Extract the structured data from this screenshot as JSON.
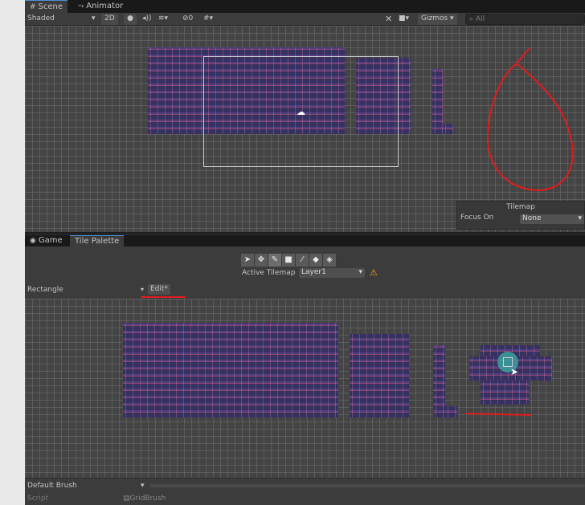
{
  "scene_tabs": [
    {
      "label": "Scene",
      "icon": "hash-icon"
    },
    {
      "label": "Animator",
      "icon": "animator-icon"
    }
  ],
  "scene_toolbar": {
    "shading_mode": "Shaded",
    "mode_2d": "2D",
    "effects_count": "0",
    "gizmos": "Gizmos",
    "search_placeholder": "All"
  },
  "tilemap_overlay": {
    "title": "Tilemap",
    "focus_label": "Focus On",
    "focus_value": "None"
  },
  "bottom_tabs": [
    {
      "label": "Game",
      "icon": "gamepad-icon"
    },
    {
      "label": "Tile Palette",
      "icon": ""
    }
  ],
  "palette": {
    "active_tilemap_label": "Active Tilemap",
    "active_tilemap_value": "Layer1",
    "palette_name": "Rectangle",
    "edit_button": "Edit*"
  },
  "footer": {
    "brush": "Default Brush",
    "script_label": "Script",
    "script_value": "GridBrush"
  },
  "colors": {
    "annotation_red": "#e31b1b",
    "tile_dark": "#1c1a36",
    "tile_accent": "#7a3048",
    "highlight_teal": "#3a9b9b"
  }
}
